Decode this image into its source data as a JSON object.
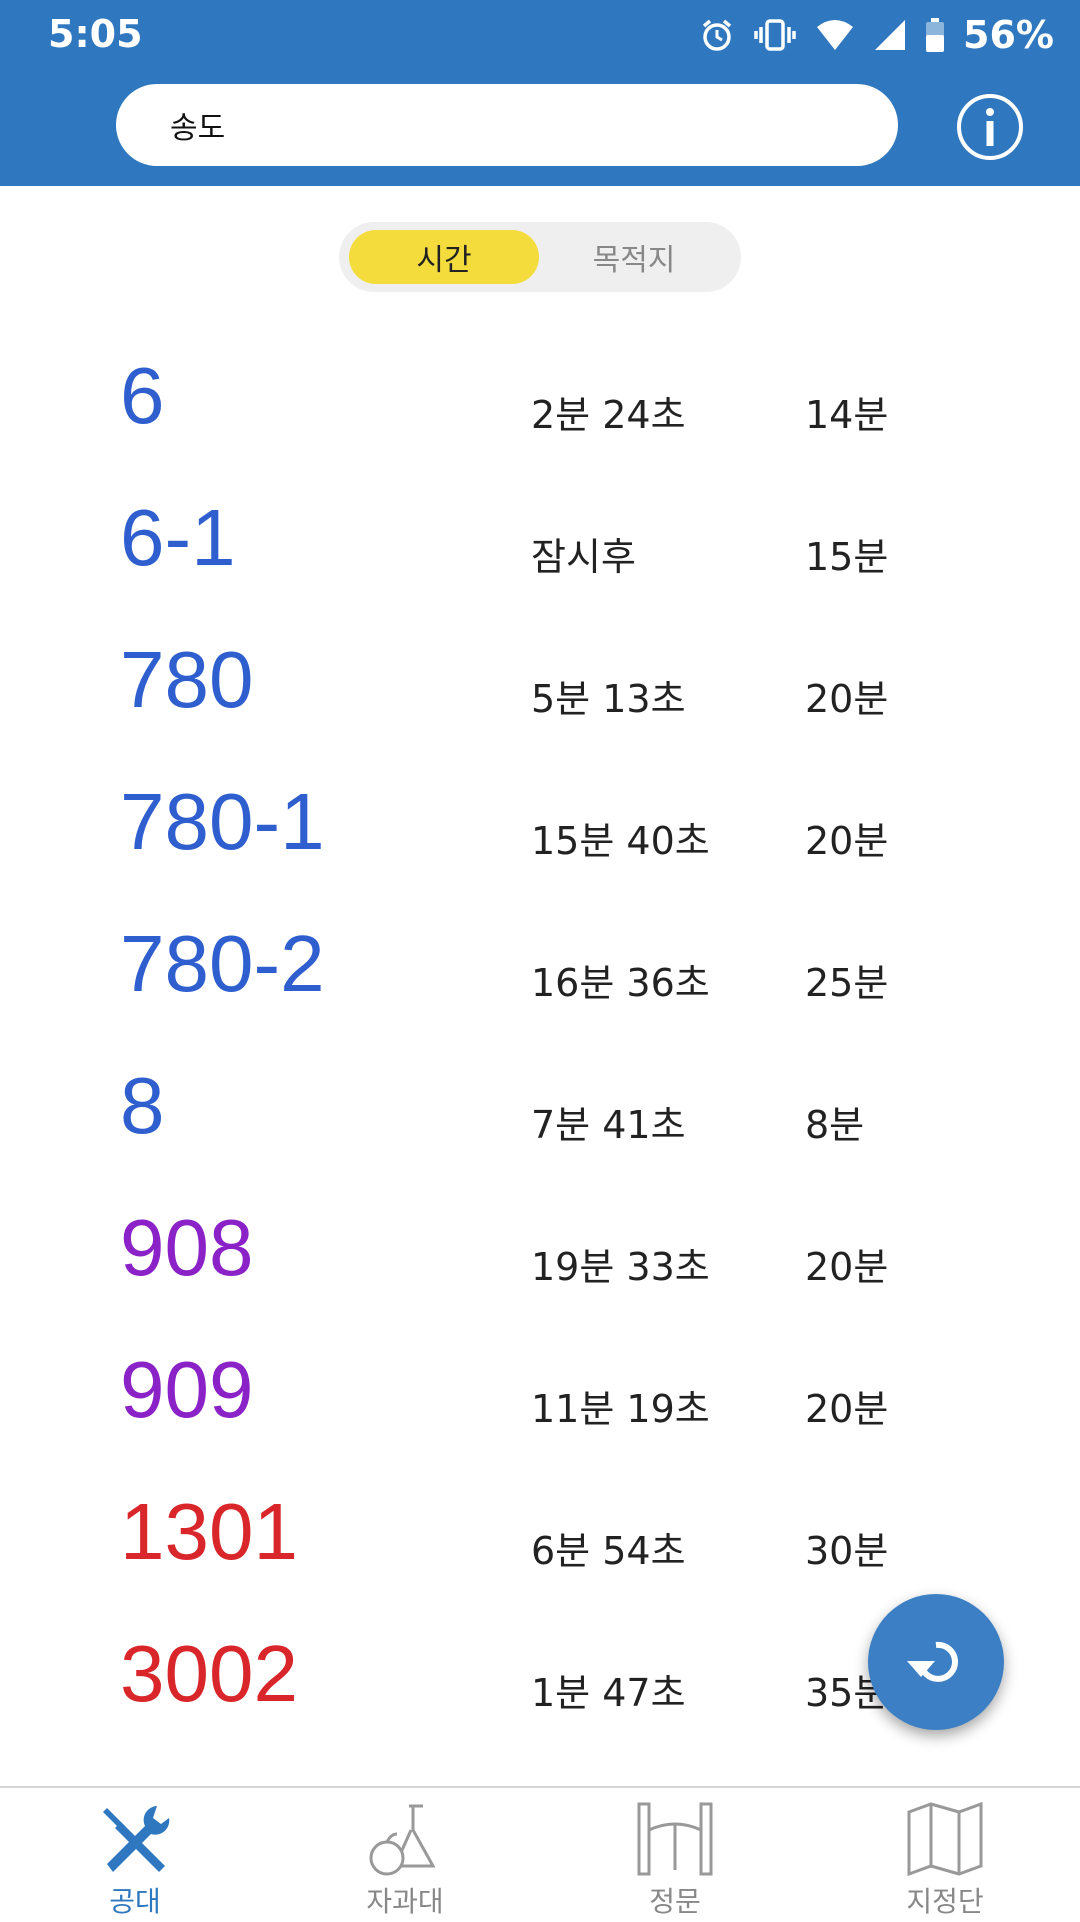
{
  "status_bar": {
    "time": "5:05",
    "battery": "56%",
    "icons": [
      "alarm-icon",
      "vibrate-icon",
      "wifi-icon",
      "signal-icon",
      "battery-icon"
    ]
  },
  "search": {
    "value": "송도"
  },
  "header": {
    "info_icon": "info-icon"
  },
  "toggle": {
    "options": [
      "시간",
      "목적지"
    ],
    "selected": "시간"
  },
  "colors": {
    "app_bar": "#2f78bf",
    "toggle_active": "#f3dc3b",
    "blue_route": "#2f5fcf",
    "purple_route": "#8b22c7",
    "red_route": "#d8262a"
  },
  "routes": [
    {
      "number": "6",
      "arrival": "2분 24초",
      "interval": "14분",
      "color": "#2f5fcf"
    },
    {
      "number": "6-1",
      "arrival": "잠시후",
      "interval": "15분",
      "color": "#2f5fcf"
    },
    {
      "number": "780",
      "arrival": "5분 13초",
      "interval": "20분",
      "color": "#2f5fcf"
    },
    {
      "number": "780-1",
      "arrival": "15분 40초",
      "interval": "20분",
      "color": "#2f5fcf"
    },
    {
      "number": "780-2",
      "arrival": "16분 36초",
      "interval": "25분",
      "color": "#2f5fcf"
    },
    {
      "number": "8",
      "arrival": "7분 41초",
      "interval": "8분",
      "color": "#2f5fcf"
    },
    {
      "number": "908",
      "arrival": "19분 33초",
      "interval": "20분",
      "color": "#8b22c7"
    },
    {
      "number": "909",
      "arrival": "11분 19초",
      "interval": "20분",
      "color": "#8b22c7"
    },
    {
      "number": "1301",
      "arrival": "6분 54초",
      "interval": "30분",
      "color": "#d8262a"
    },
    {
      "number": "3002",
      "arrival": "1분 47초",
      "interval": "35분",
      "color": "#d8262a"
    }
  ],
  "fab": {
    "icon": "refresh-icon"
  },
  "bottom_nav": [
    {
      "label": "공대",
      "icon": "tools-icon",
      "active": true
    },
    {
      "label": "자과대",
      "icon": "science-flask-icon",
      "active": false
    },
    {
      "label": "정문",
      "icon": "gate-icon",
      "active": false
    },
    {
      "label": "지정단",
      "icon": "map-icon",
      "active": false
    }
  ]
}
